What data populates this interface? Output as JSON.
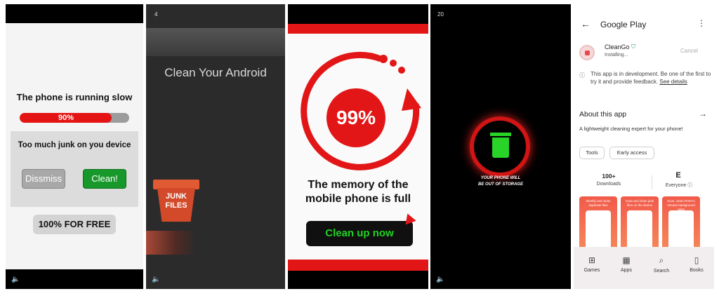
{
  "panel1": {
    "title": "The phone is running slow",
    "progress_label": "90%",
    "progress_value": 0.9,
    "dialog_message": "Too much junk on you device",
    "dismiss_label": "Dissmiss",
    "clean_label": "Clean!",
    "free_label": "100% FOR FREE",
    "volume_icon": "speaker-icon"
  },
  "panel2": {
    "counter": "4",
    "title": "Clean Your Android",
    "bin_label_line1": "JUNK",
    "bin_label_line2": "FILES"
  },
  "panel3": {
    "percent": "99%",
    "message_line1": "The memory of the",
    "message_line2": "mobile phone is full",
    "button_label": "Clean up now"
  },
  "panel4": {
    "counter": "20",
    "warning_line1": "YOUR PHONE WILL",
    "warning_line2": "BE OUT OF STORAGE"
  },
  "panel5": {
    "header_title": "Google Play",
    "app_name": "CleanGo",
    "status": "Installing...",
    "cancel_label": "Cancel",
    "dev_note": "This app is in development. Be one of the first to try it and provide feedback.",
    "see_details": "See details",
    "about_title": "About this app",
    "description": "A lightweight cleaning expert for your phone!",
    "tags": [
      "Tools",
      "Early access"
    ],
    "downloads_value": "100+",
    "downloads_label": "Downloads",
    "rating_value": "E",
    "rating_label": "Everyone ⓘ",
    "screenshots": [
      "Identify and clean duplicate files",
      "Scan and clean junk files on the device",
      "Scan, clean RAM to release background apps"
    ],
    "nav": [
      {
        "label": "Games",
        "icon": "gamepad-icon"
      },
      {
        "label": "Apps",
        "icon": "apps-grid-icon"
      },
      {
        "label": "Search",
        "icon": "search-icon"
      },
      {
        "label": "Books",
        "icon": "book-icon"
      }
    ]
  }
}
